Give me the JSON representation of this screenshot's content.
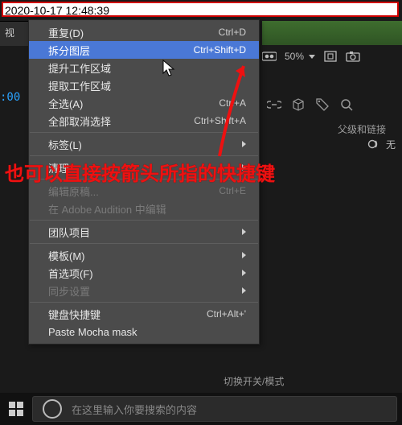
{
  "timestamp": "2020-10-17 12:48:39",
  "tab_label": "视",
  "toolbar": {
    "zoom": "50%"
  },
  "timeline": {
    "time_fragment": ":00"
  },
  "headers": {
    "parent_link": "父级和链接"
  },
  "link_row": {
    "none_label": "无"
  },
  "annotation": "也可以直接按箭头所指的快捷键",
  "switches_label": "切换开关/模式",
  "search_placeholder": "在这里输入你要搜索的内容",
  "menu": {
    "items": [
      {
        "label": "重复(D)",
        "shortcut": "Ctrl+D",
        "enabled": true
      },
      {
        "label": "拆分图层",
        "shortcut": "Ctrl+Shift+D",
        "enabled": true,
        "highlight": true
      },
      {
        "label": "提升工作区域",
        "shortcut": "",
        "enabled": true
      },
      {
        "label": "提取工作区域",
        "shortcut": "",
        "enabled": true
      },
      {
        "label": "全选(A)",
        "shortcut": "Ctrl+A",
        "enabled": true
      },
      {
        "label": "全部取消选择",
        "shortcut": "Ctrl+Shift+A",
        "enabled": true
      },
      {
        "sep": true
      },
      {
        "label": "标签(L)",
        "shortcut": "",
        "enabled": true,
        "submenu": true
      },
      {
        "sep": true
      },
      {
        "label": "清理",
        "shortcut": "",
        "enabled": true,
        "submenu": true
      },
      {
        "sep": true
      },
      {
        "label": "编辑原稿...",
        "shortcut": "Ctrl+E",
        "enabled": false
      },
      {
        "label": "在 Adobe Audition 中编辑",
        "shortcut": "",
        "enabled": false
      },
      {
        "sep": true
      },
      {
        "label": "团队项目",
        "shortcut": "",
        "enabled": true,
        "submenu": true
      },
      {
        "sep": true
      },
      {
        "label": "模板(M)",
        "shortcut": "",
        "enabled": true,
        "submenu": true
      },
      {
        "label": "首选项(F)",
        "shortcut": "",
        "enabled": true,
        "submenu": true
      },
      {
        "label": "同步设置",
        "shortcut": "",
        "enabled": false,
        "submenu": true
      },
      {
        "sep": true
      },
      {
        "label": "键盘快捷键",
        "shortcut": "Ctrl+Alt+'",
        "enabled": true
      },
      {
        "label": "Paste Mocha mask",
        "shortcut": "",
        "enabled": true
      }
    ]
  }
}
